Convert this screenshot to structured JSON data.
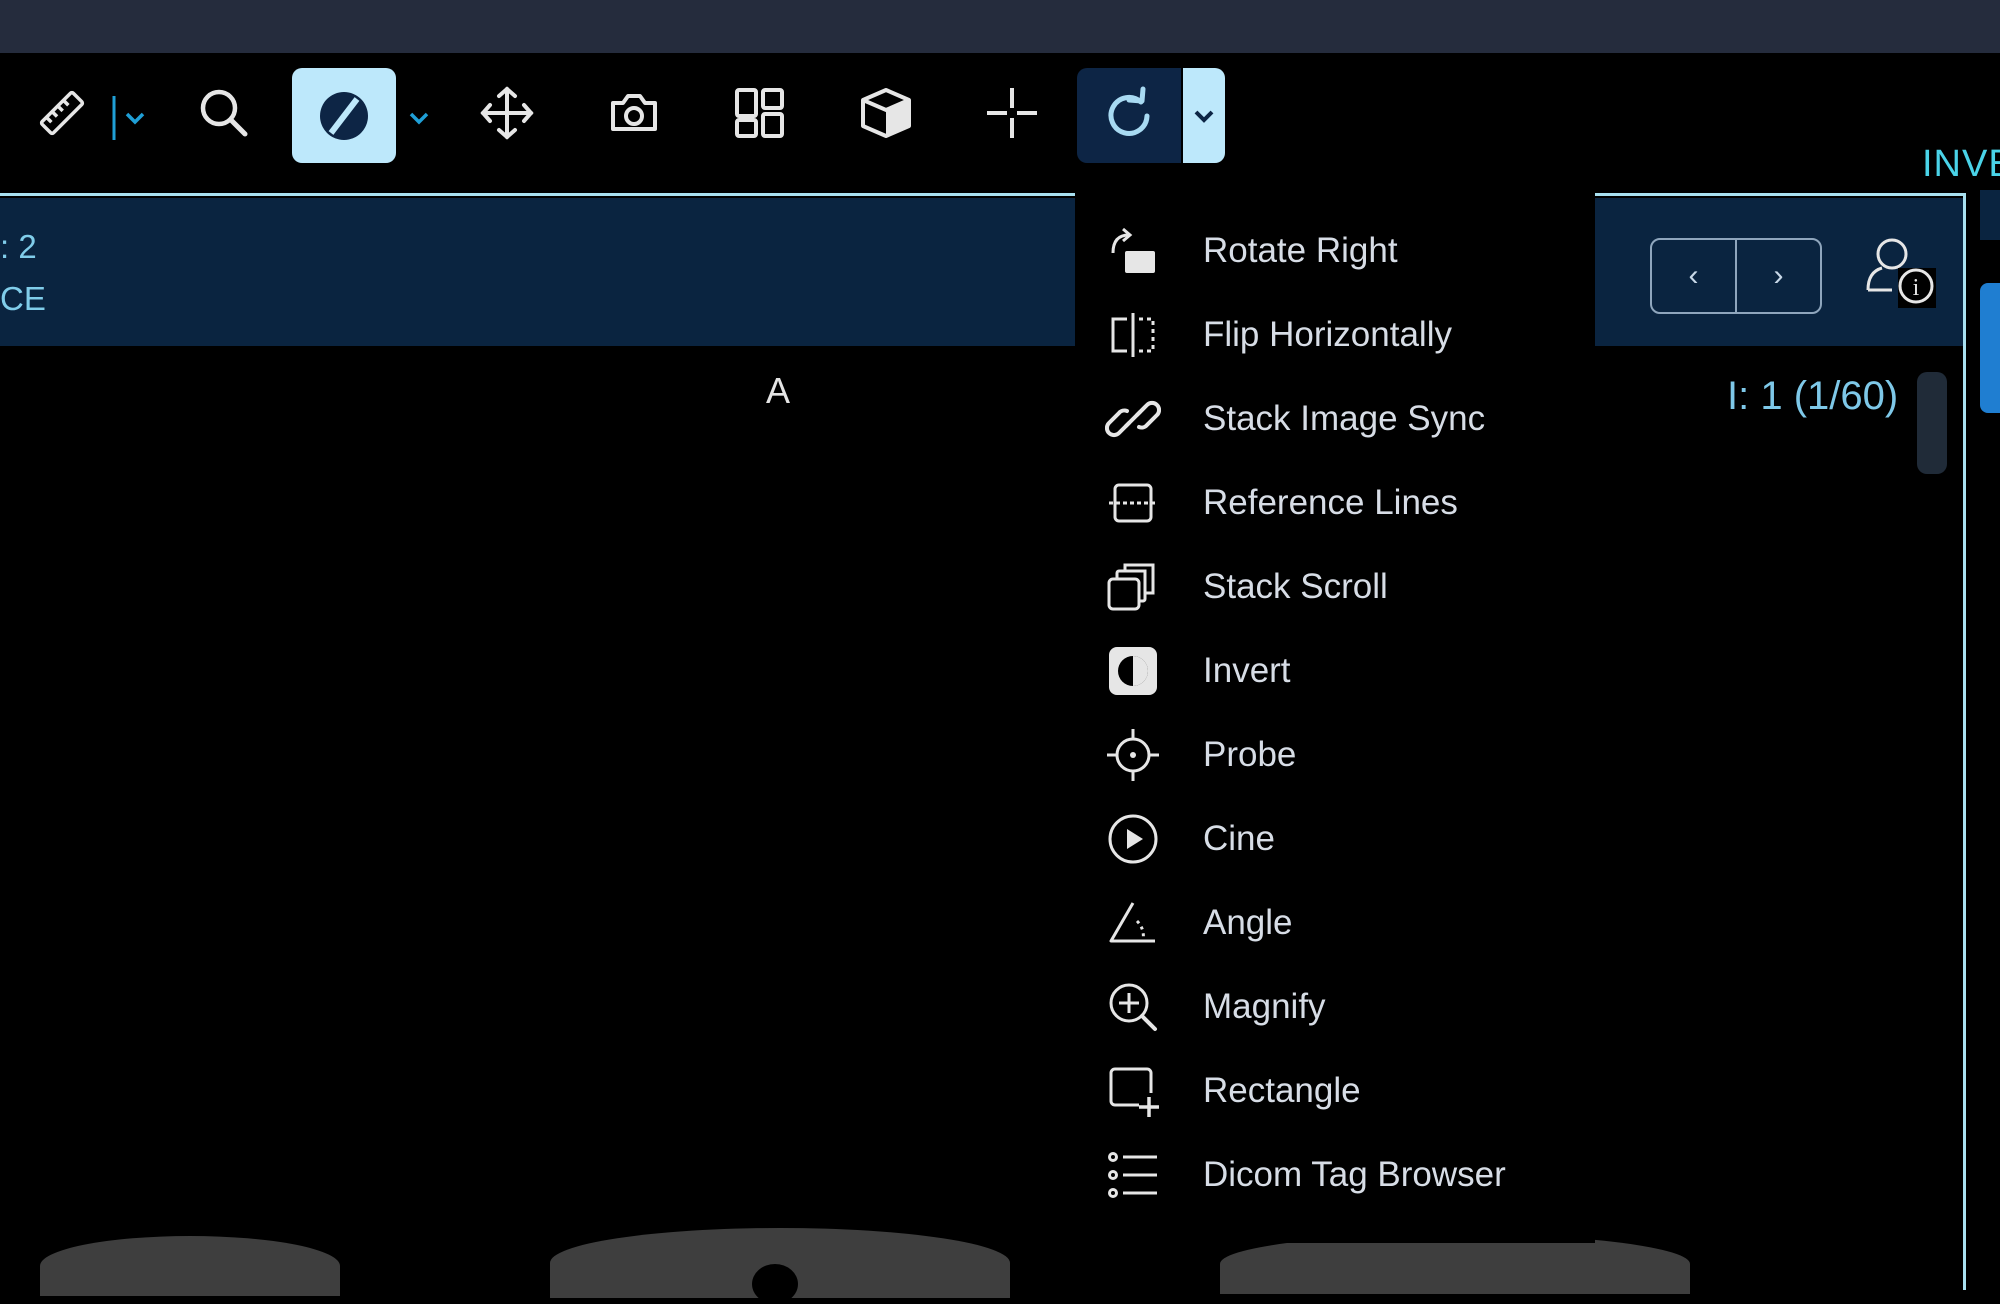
{
  "toolbar": {
    "right_label": "INVE",
    "tools": [
      {
        "icon": "ruler-icon"
      },
      {
        "icon": "search-icon"
      },
      {
        "icon": "contrast-icon",
        "active": true
      },
      {
        "icon": "move-icon"
      },
      {
        "icon": "camera-icon"
      },
      {
        "icon": "layout-grid-icon"
      },
      {
        "icon": "cube-icon"
      },
      {
        "icon": "crosshair-icon"
      },
      {
        "icon": "rotate-icon",
        "active": true
      }
    ],
    "active_color": "#bde8fb",
    "accent_color": "#1f7ed1"
  },
  "viewport": {
    "header_line1": ": 2",
    "header_line2": "CE",
    "orientation_marker": "A",
    "image_index": "I: 1 (1/60)",
    "prev_label": "‹",
    "next_label": "›"
  },
  "menu": {
    "items": [
      {
        "label": "Rotate Right",
        "icon": "rotate-right-icon"
      },
      {
        "label": "Flip Horizontally",
        "icon": "flip-horizontal-icon"
      },
      {
        "label": "Stack Image Sync",
        "icon": "link-icon"
      },
      {
        "label": "Reference Lines",
        "icon": "reference-lines-icon"
      },
      {
        "label": "Stack Scroll",
        "icon": "stack-scroll-icon"
      },
      {
        "label": "Invert",
        "icon": "invert-icon"
      },
      {
        "label": "Probe",
        "icon": "probe-icon"
      },
      {
        "label": "Cine",
        "icon": "cine-icon"
      },
      {
        "label": "Angle",
        "icon": "angle-icon"
      },
      {
        "label": "Magnify",
        "icon": "magnify-icon"
      },
      {
        "label": "Rectangle",
        "icon": "rectangle-icon"
      },
      {
        "label": "Dicom Tag Browser",
        "icon": "list-icon"
      }
    ]
  }
}
